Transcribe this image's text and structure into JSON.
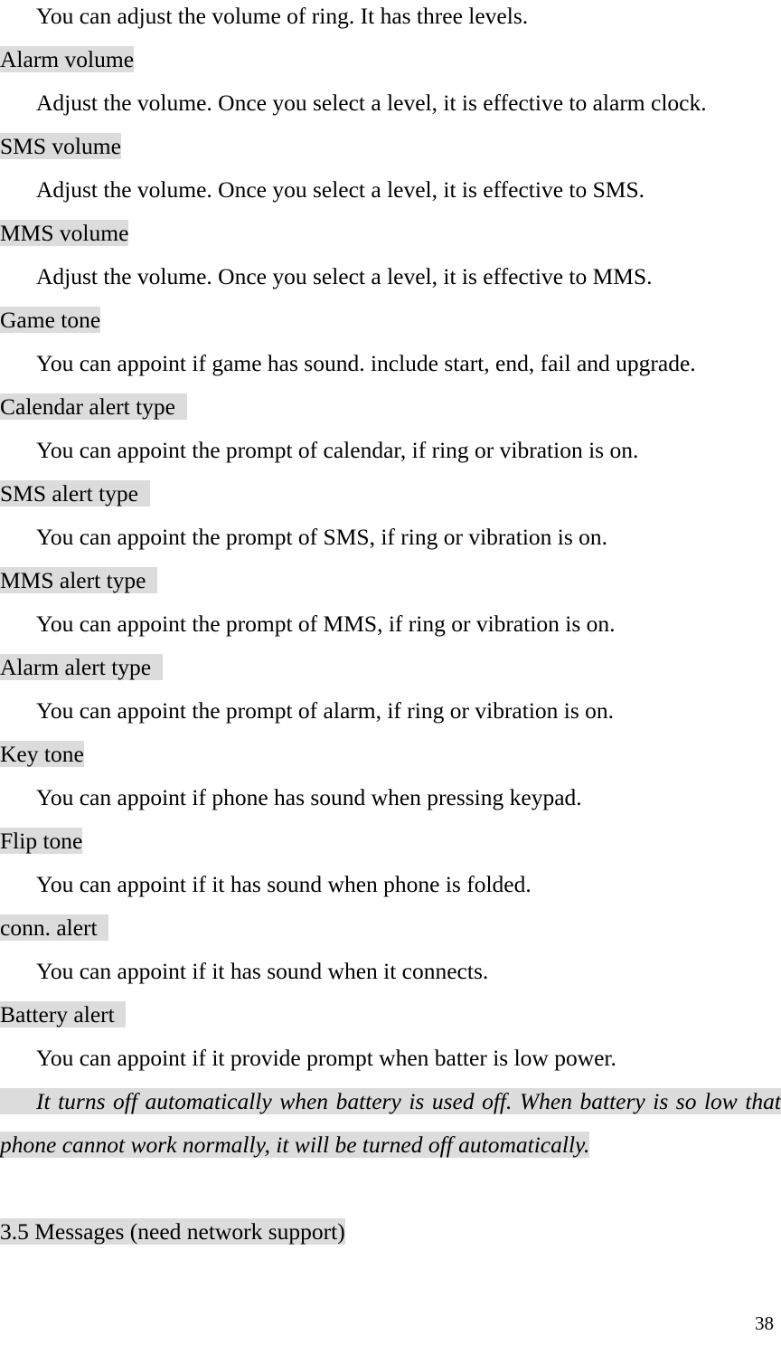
{
  "document": {
    "page_number": "38",
    "highlight_color": "#dcdcdc",
    "intro_paragraph": "You can adjust the volume of ring. It has three levels.",
    "entries": [
      {
        "heading": "Alarm volume",
        "body": "Adjust the volume. Once you select a level, it is effective to alarm clock."
      },
      {
        "heading": "SMS volume",
        "body": "Adjust the volume. Once you select a level, it is effective to SMS."
      },
      {
        "heading": "MMS volume",
        "body": "Adjust the volume. Once you select a level, it is effective to MMS."
      },
      {
        "heading": "Game tone",
        "body": "You can appoint if game has sound. include start, end, fail and upgrade."
      },
      {
        "heading": "Calendar alert type  ",
        "body": "You can appoint the prompt of calendar, if ring or vibration is on."
      },
      {
        "heading": "SMS alert type  ",
        "body": "You can appoint the prompt of SMS, if ring or vibration is on."
      },
      {
        "heading": "MMS alert type  ",
        "body": "You can appoint the prompt of MMS, if ring or vibration is on."
      },
      {
        "heading": "Alarm alert type  ",
        "body": "You can appoint the prompt of alarm, if ring or vibration is on."
      },
      {
        "heading": "Key tone",
        "body": "You can appoint if phone has sound when pressing keypad."
      },
      {
        "heading": "Flip tone",
        "body": "You can appoint if it has sound when phone is folded."
      },
      {
        "heading": "conn. alert  ",
        "body": "You can appoint if it has sound when it connects."
      },
      {
        "heading": "Battery alert  ",
        "body": "You can appoint if it provide prompt when batter is low power."
      }
    ],
    "note": {
      "text": "It turns off automatically when battery is used off. When battery is so low that phone cannot work normally, it will be turned off automatically.",
      "trailing": " "
    },
    "section_heading": "3.5 Messages (need network support)"
  }
}
